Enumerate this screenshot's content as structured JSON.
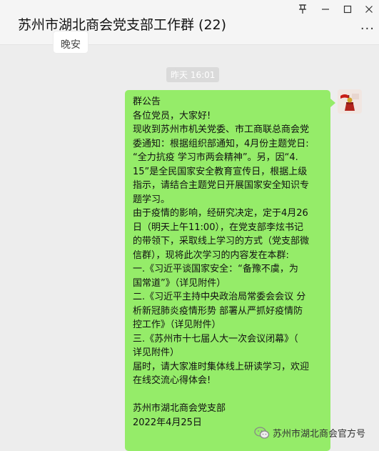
{
  "window": {
    "title": "苏州市湖北商会党支部工作群 (22)",
    "controls": {
      "pin": "⊼",
      "minimize": "—",
      "maximize": "□",
      "close": "✕"
    },
    "more": "···"
  },
  "chat": {
    "prev_bubble_text": "晚安",
    "timestamp": "昨天 16:01",
    "message": {
      "lines": [
        "群公告",
        "各位党员，大家好!",
        "现收到苏州市机关党委、市工商联总商会党",
        "委通知：根据组织部通知，4月份主题党日:",
        "“全力抗疫 学习市两会精神”。另，因“4.",
        "15”是全民国家安全教育宣传日，根据上级",
        "指示，请结合主题党日开展国家安全知识专",
        "题学习。",
        "由于疫情的影响，经研究决定，定于4月26",
        "日（明天上午11:00），在党支部李炫书记",
        "的带领下，采取线上学习的方式（党支部微",
        "信群），现将此次学习的内容发在本群:",
        "一.《习近平谈国家安全：“备豫不虞，为",
        "国常道”》（详见附件）",
        "二.《习近平主持中央政治局常委会会议 分",
        "析新冠肺炎疫情形势 部署从严抓好疫情防",
        "控工作》（详见附件）",
        "三.《苏州市十七届人大一次会议闭幕》（",
        "详见附件）",
        "届时，请大家准时集体线上研读学习，欢迎",
        "在线交流心得体会!",
        "",
        "苏州市湖北商会党支部",
        "2022年4月25日"
      ],
      "bubble_color": "#95ec69"
    }
  },
  "watermark": {
    "text": "苏州市湖北商会官方号",
    "icon": "wechat-icon"
  },
  "colors": {
    "background": "#ededed",
    "titlebar": "#f5f5f5",
    "bubble": "#95ec69",
    "timestamp_bg": "#dadada"
  }
}
